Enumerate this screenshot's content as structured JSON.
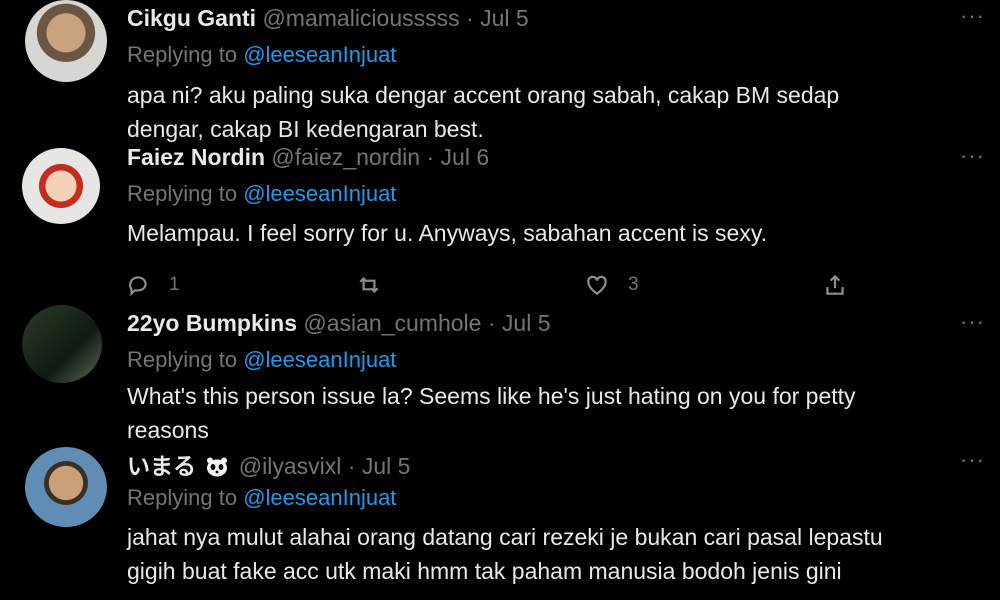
{
  "tweets": [
    {
      "name": "Cikgu Ganti",
      "handle": "@mamaliciousssss",
      "date": "Jul 5",
      "replying_prefix": "Replying to",
      "replying_handle": "@leeseanInjuat",
      "lines": [
        "apa ni? aku paling suka dengar accent orang sabah, cakap BM sedap",
        "dengar, cakap BI kedengaran best."
      ]
    },
    {
      "name": "Faiez Nordin",
      "handle": "@faiez_nordin",
      "date": "Jul 6",
      "replying_prefix": "Replying to",
      "replying_handle": "@leeseanInjuat",
      "lines": [
        "Melampau. I feel sorry for u. Anyways, sabahan accent is sexy."
      ],
      "actions": {
        "reply_count": "1",
        "retweet_count": "",
        "like_count": "3"
      }
    },
    {
      "name": "22yo Bumpkins",
      "handle": "@asian_cumhole",
      "date": "Jul 5",
      "replying_prefix": "Replying to",
      "replying_handle": "@leeseanInjuat",
      "lines": [
        "What's this person issue la? Seems like he's just hating on you for petty",
        "reasons"
      ]
    },
    {
      "name": "いまる",
      "handle": "@ilyasvixl",
      "date": "Jul 5",
      "replying_prefix": "Replying to",
      "replying_handle": "@leeseanInjuat",
      "lines": [
        "jahat nya mulut alahai orang datang cari rezeki je bukan cari pasal lepastu",
        "gigih buat fake acc utk maki hmm tak paham manusia bodoh jenis gini"
      ]
    }
  ],
  "more_label": "···",
  "sep": "·",
  "icons": [
    "reply-icon",
    "retweet-icon",
    "like-icon",
    "share-icon",
    "panda-emoji-icon"
  ],
  "colors": {
    "background": "#000000",
    "text": "#e7e9ea",
    "muted": "#71767b",
    "link": "#1d9bf0"
  }
}
